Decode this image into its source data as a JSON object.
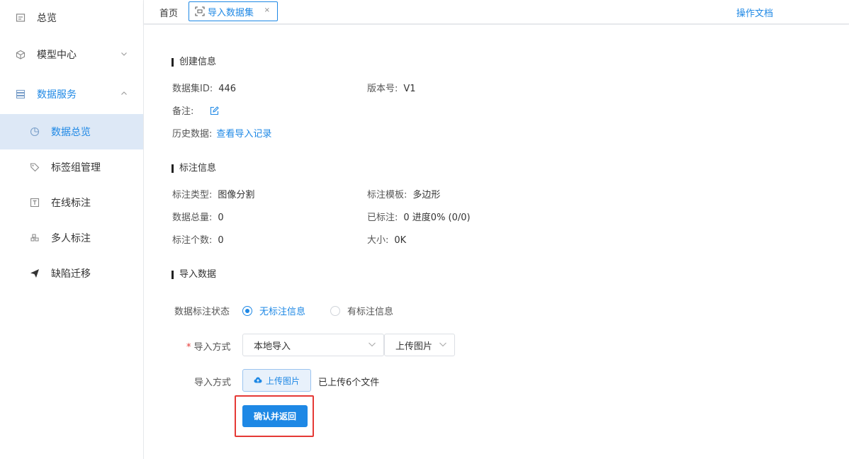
{
  "sidebar": {
    "items": [
      {
        "label": "总览",
        "icon": "overview-icon"
      },
      {
        "label": "模型中心",
        "icon": "cube-icon"
      },
      {
        "label": "数据服务",
        "icon": "server-icon"
      },
      {
        "label": "数据总览",
        "icon": "pie-chart-icon"
      },
      {
        "label": "标签组管理",
        "icon": "tag-icon"
      },
      {
        "label": "在线标注",
        "icon": "text-box-icon"
      },
      {
        "label": "多人标注",
        "icon": "cubes-icon"
      },
      {
        "label": "缺陷迁移",
        "icon": "paper-plane-icon"
      }
    ]
  },
  "tabbar": {
    "home": "首页",
    "active_tab": "导入数据集",
    "close": "×",
    "doc_link": "操作文档"
  },
  "create_info": {
    "title": "创建信息",
    "dataset_id_label": "数据集ID:",
    "dataset_id": "446",
    "version_label": "版本号:",
    "version": "V1",
    "remark_label": "备注:",
    "history_label": "历史数据:",
    "history_link": "查看导入记录"
  },
  "annotation_info": {
    "title": "标注信息",
    "type_label": "标注类型:",
    "type": "图像分割",
    "template_label": "标注模板:",
    "template": "多边形",
    "total_label": "数据总量:",
    "total": "0",
    "labeled_label": "已标注:",
    "labeled": "0 进度0% (0/0)",
    "count_label": "标注个数:",
    "count": "0",
    "size_label": "大小:",
    "size": "0K"
  },
  "import_data": {
    "title": "导入数据",
    "status_label": "数据标注状态",
    "radio_none": "无标注信息",
    "radio_has": "有标注信息",
    "method_label": "导入方式",
    "required_mark": "*",
    "method_select": "本地导入",
    "type_select": "上传图片",
    "method_label2": "导入方式",
    "upload_button": "上传图片",
    "upload_note": "已上传6个文件",
    "confirm_button": "确认并返回"
  },
  "colors": {
    "accent": "#1e88e5",
    "highlight": "#e53935",
    "active_bg": "#dde8f6"
  }
}
